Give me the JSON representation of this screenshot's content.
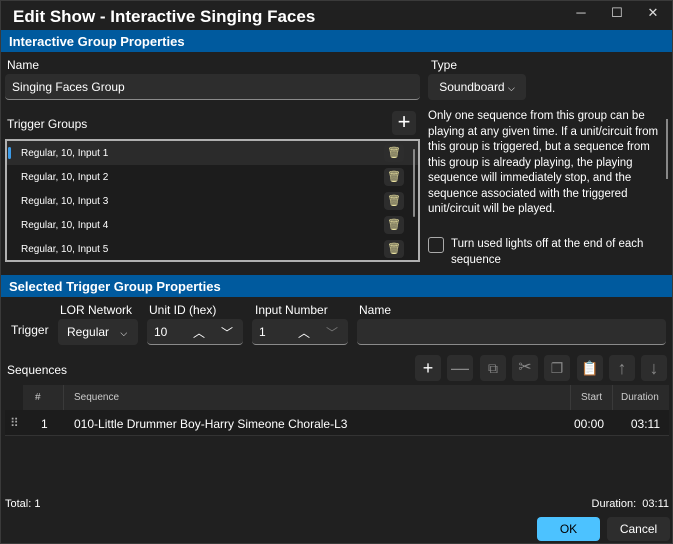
{
  "window": {
    "title": "Edit Show - Interactive Singing Faces"
  },
  "group_props": {
    "header": "Interactive Group Properties",
    "name_label": "Name",
    "name_value": "Singing Faces Group",
    "type_label": "Type",
    "type_value": "Soundboard",
    "trigger_groups_label": "Trigger Groups",
    "description": "Only one sequence from this group can be playing at any given time. If a unit/circuit from this group is triggered, but a sequence from this group is already playing, the playing sequence will immediately stop, and the sequence associated with the triggered unit/circuit will be played.",
    "checkbox_label": "Turn used lights off at the end of each sequence",
    "checkbox_checked": false,
    "trigger_groups": [
      "Regular, 10, Input 1",
      "Regular, 10, Input 2",
      "Regular, 10, Input 3",
      "Regular, 10, Input 4",
      "Regular, 10, Input 5"
    ]
  },
  "selected": {
    "header": "Selected Trigger Group Properties",
    "trigger_label": "Trigger",
    "network_label": "LOR Network",
    "network_value": "Regular",
    "unit_label": "Unit ID (hex)",
    "unit_value": "10",
    "input_label": "Input Number",
    "input_value": "1",
    "name_label": "Name",
    "name_value": ""
  },
  "sequences": {
    "label": "Sequences",
    "columns": [
      "#",
      "Sequence",
      "Start",
      "Duration"
    ],
    "rows": [
      {
        "num": "1",
        "sequence": "010-Little Drummer Boy-Harry Simeone Chorale-L3",
        "start": "00:00",
        "duration": "03:11"
      }
    ]
  },
  "footer": {
    "total": "Total: 1",
    "duration": "Duration:  03:11",
    "ok": "OK",
    "cancel": "Cancel"
  },
  "colors": {
    "accent": "#005a9e",
    "ok": "#4cc2ff"
  }
}
